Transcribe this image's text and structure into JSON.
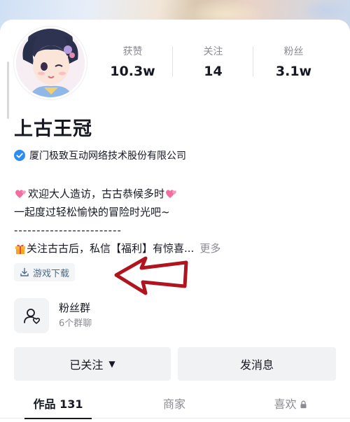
{
  "profile": {
    "name": "上古王冠",
    "verified_org": "厦门极致互动网络技术股份有限公司"
  },
  "stats": [
    {
      "label": "获赞",
      "value": "10.3w"
    },
    {
      "label": "关注",
      "value": "14"
    },
    {
      "label": "粉丝",
      "value": "3.1w"
    }
  ],
  "bio": {
    "line1": "欢迎大人造访，古古恭候多时",
    "line2": "一起度过轻松愉快的冒险时光吧~",
    "line3": "------------------------",
    "line4": "关注古古后，私信【福利】有惊喜...",
    "more": "更多"
  },
  "download_chip": "游戏下载",
  "fan_group": {
    "name": "粉丝群",
    "count": "6个群聊"
  },
  "buttons": {
    "follow": "已关注",
    "message": "发消息"
  },
  "tabs": [
    {
      "label": "作品 131",
      "active": true
    },
    {
      "label": "商家",
      "active": false
    },
    {
      "label": "喜欢",
      "active": false,
      "locked": true
    }
  ],
  "icons": {
    "heart": "heart-icon",
    "gift": "gift-icon",
    "verified": "verified-check-icon",
    "download": "download-icon",
    "fan_group": "fan-group-icon",
    "caret": "caret-down-icon",
    "lock": "lock-icon"
  },
  "colors": {
    "text": "#161823",
    "muted": "#8a8b91",
    "verified": "#2e8cf0",
    "heart": "#f06ea0",
    "gift": "#f0a830",
    "arrow": "#b0141e"
  }
}
